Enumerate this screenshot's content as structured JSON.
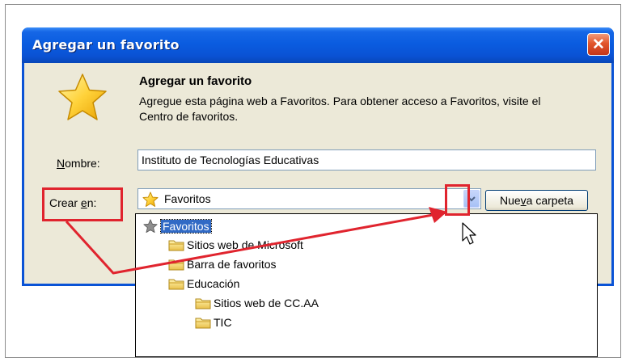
{
  "dialog": {
    "title": "Agregar un favorito",
    "heading": "Agregar un favorito",
    "description": "Agregue esta página web a Favoritos. Para obtener acceso a Favoritos, visite el Centro de favoritos.",
    "name_label_key": "N",
    "name_label_rest": "ombre:",
    "name_value": "Instituto de Tecnologías Educativas",
    "create_label_pre": "Crear ",
    "create_label_key": "e",
    "create_label_post": "n:",
    "combo_value": "Favoritos",
    "new_folder_pre": "Nue",
    "new_folder_key": "v",
    "new_folder_post": "a carpeta"
  },
  "tree": [
    {
      "label": "Favoritos",
      "icon": "gray-star-icon",
      "level": 0,
      "selected": true
    },
    {
      "label": "Sitios web de Microsoft",
      "icon": "folder-icon",
      "level": 1
    },
    {
      "label": "Barra de favoritos",
      "icon": "folder-icon",
      "level": 1
    },
    {
      "label": "Educación",
      "icon": "folder-icon",
      "level": 1
    },
    {
      "label": "Sitios web de CC.AA",
      "icon": "folder-icon",
      "level": 2
    },
    {
      "label": "TIC",
      "icon": "folder-icon",
      "level": 2
    }
  ],
  "colors": {
    "titlebar": "#0a5ce0",
    "dialog_bg": "#ece9d8",
    "annotation_red": "#e0242e",
    "selection": "#316ac5"
  }
}
